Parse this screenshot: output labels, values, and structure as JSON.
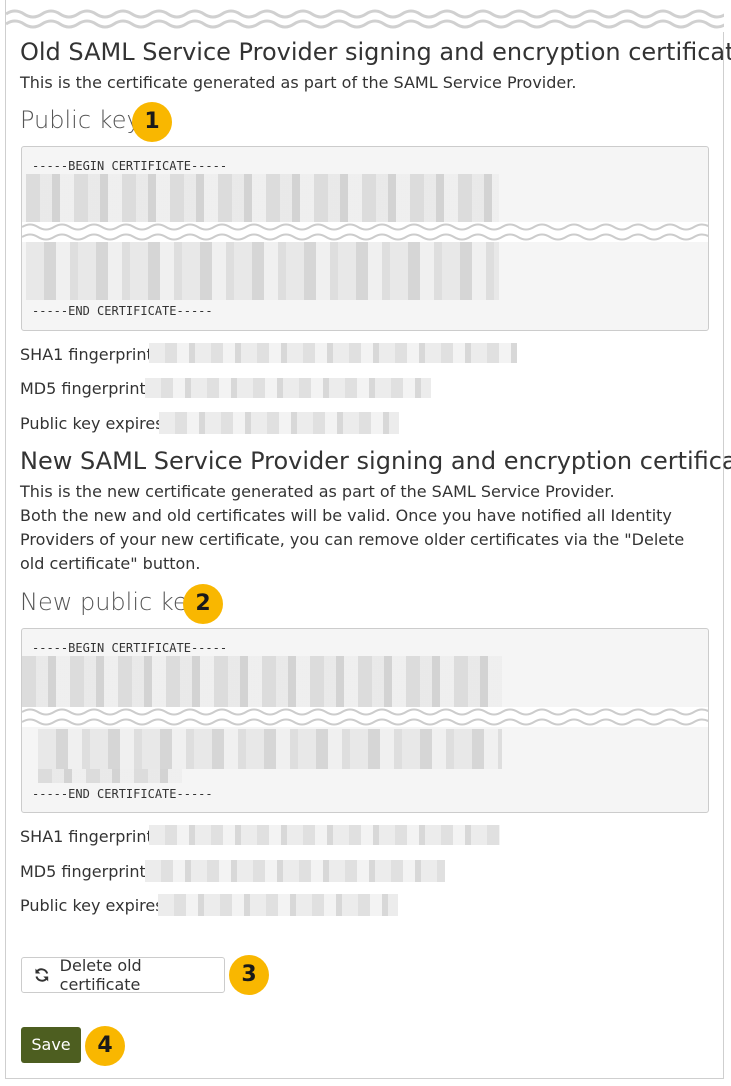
{
  "old_section": {
    "title": "Old SAML Service Provider signing and encryption certificate",
    "description": "This is the certificate generated as part of the SAML Service Provider.",
    "key_heading": "Public key",
    "cert_begin": "-----BEGIN CERTIFICATE-----",
    "cert_end": "-----END CERTIFICATE-----",
    "sha1_label": "SHA1 fingerprint:",
    "md5_label": "MD5 fingerprint:",
    "expires_label": "Public key expires:"
  },
  "new_section": {
    "title": "New SAML Service Provider signing and encryption certificate",
    "description_1": "This is the new certificate generated as part of the SAML Service Provider.",
    "description_2": "Both the new and old certificates will be valid. Once you have notified all Identity Providers of your new certificate, you can remove older certificates via the \"Delete old certificate\" button.",
    "key_heading": "New public key",
    "cert_begin": "-----BEGIN CERTIFICATE-----",
    "cert_end": "-----END CERTIFICATE-----",
    "sha1_label": "SHA1 fingerprint:",
    "md5_label": "MD5 fingerprint:",
    "expires_label": "Public key expires:"
  },
  "actions": {
    "delete_label": "Delete old certificate",
    "save_label": "Save",
    "delete_icon": "refresh-icon"
  },
  "callouts": [
    "1",
    "2",
    "3",
    "4"
  ],
  "colors": {
    "callout": "#f9b700",
    "save_button": "#4d5e20",
    "cert_background": "#f5f5f5"
  }
}
